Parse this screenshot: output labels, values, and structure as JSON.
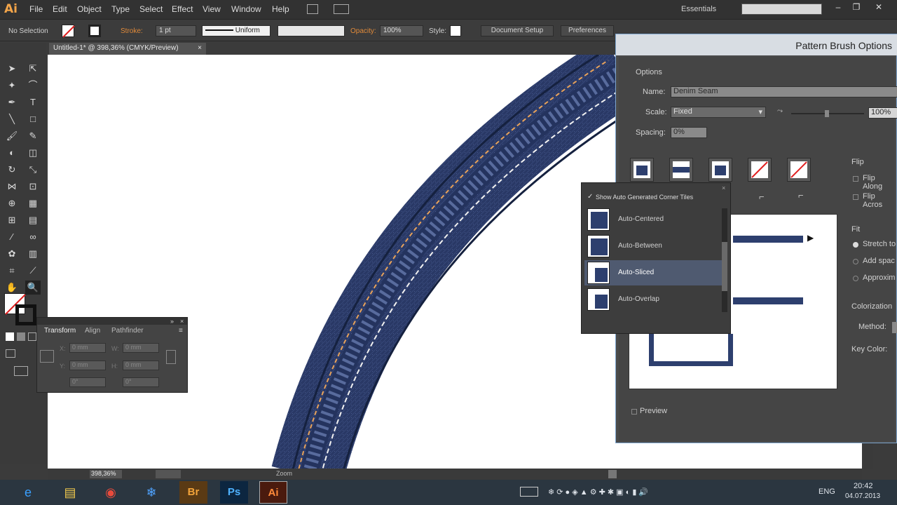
{
  "menubar": {
    "logo": "Ai",
    "items": [
      "File",
      "Edit",
      "Object",
      "Type",
      "Select",
      "Effect",
      "View",
      "Window",
      "Help"
    ],
    "workspace": "Essentials"
  },
  "controlbar": {
    "selection": "No Selection",
    "stroke_label": "Stroke:",
    "stroke_value": "1 pt",
    "profile": "Uniform",
    "opacity_label": "Opacity:",
    "opacity_value": "100%",
    "style_label": "Style:",
    "document_setup": "Document Setup",
    "preferences": "Preferences"
  },
  "document": {
    "tab_title": "Untitled-1* @ 398,36% (CMYK/Preview)",
    "zoom_value": "398,36%",
    "status_label": "Zoom"
  },
  "transform_panel": {
    "tabs": [
      "Transform",
      "Align",
      "Pathfinder"
    ],
    "x_label": "X:",
    "y_label": "Y:",
    "w_label": "W:",
    "h_label": "H:",
    "x": "0 mm",
    "y": "0 mm",
    "w": "0 mm",
    "h": "0 mm",
    "rotate": "0°",
    "shear": "0°"
  },
  "dialog": {
    "title": "Pattern Brush Options",
    "options_heading": "Options",
    "name_label": "Name:",
    "name_value": "Denim Seam",
    "scale_label": "Scale:",
    "scale_value": "Fixed",
    "scale_percent": "100%",
    "spacing_label": "Spacing:",
    "spacing_value": "0%",
    "flip_heading": "Flip",
    "flip_along": "Flip Along",
    "flip_across": "Flip Acros",
    "fit_heading": "Fit",
    "fit_options": [
      "Stretch to",
      "Add spac",
      "Approxim"
    ],
    "colorization_heading": "Colorization",
    "method_label": "Method:",
    "key_color_label": "Key Color:",
    "preview_label": "Preview"
  },
  "dropdown": {
    "show_auto_label": "Show Auto Generated Corner Tiles",
    "items": [
      "Auto-Centered",
      "Auto-Between",
      "Auto-Sliced",
      "Auto-Overlap"
    ],
    "selected_index": 2
  },
  "taskbar": {
    "language": "ENG",
    "time": "20:42",
    "date": "04.07.2013",
    "apps": [
      "Br",
      "Ps",
      "Ai"
    ]
  },
  "colors": {
    "denim": "#2c3d6b",
    "stitch_orange": "#e8a25a",
    "dialog_border": "#7fa7d0",
    "selected_item": "#4f5a70"
  }
}
